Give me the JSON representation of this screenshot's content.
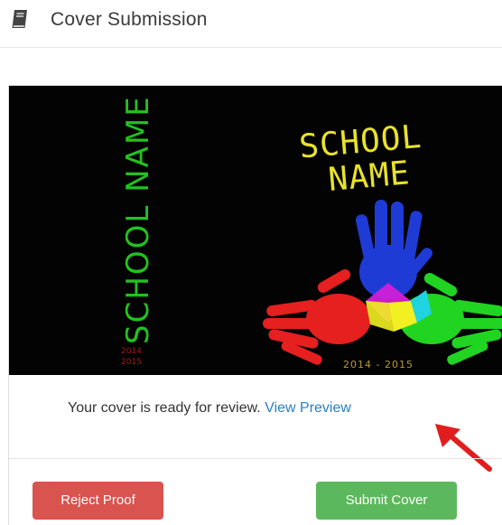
{
  "header": {
    "icon": "book-icon",
    "title": "Cover Submission"
  },
  "cover": {
    "spine_text": "SCHOOL NAME",
    "spine_years": [
      "2014",
      "2015"
    ],
    "front_title_line1": "SCHOOL",
    "front_title_line2": "NAME",
    "front_years": "2014 - 2015",
    "colors": {
      "background": "#030303",
      "spine_text": "#22c21e",
      "front_title": "#e8e22a",
      "hand_blue": "#1f3bd6",
      "hand_red": "#e61f1f",
      "hand_green": "#21d421",
      "hand_center_magenta": "#d21fd8",
      "hand_center_yellow": "#f2ef22",
      "hand_center_cyan": "#1fd4e0"
    }
  },
  "message": {
    "text": "Your cover is ready for review.",
    "link": "View Preview"
  },
  "annotation": {
    "icon": "red-arrow-icon",
    "color": "#e01e1e"
  },
  "actions": {
    "reject_label": "Reject Proof",
    "submit_label": "Submit Cover",
    "reject_color": "#d9534f",
    "submit_color": "#5cb85c"
  }
}
